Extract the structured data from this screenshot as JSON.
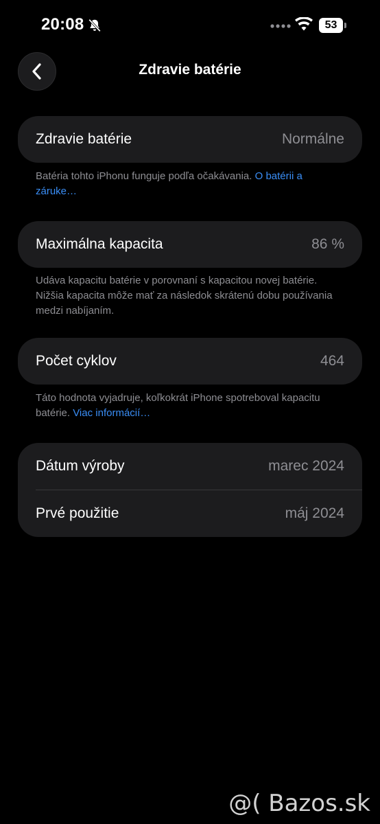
{
  "status_bar": {
    "time": "20:08",
    "battery_level": 53,
    "battery_text": "53"
  },
  "nav": {
    "title": "Zdravie batérie"
  },
  "health": {
    "label": "Zdravie batérie",
    "value": "Normálne",
    "note": "Batéria tohto iPhonu funguje podľa očakávania. ",
    "link": "O batérii a záruke…"
  },
  "capacity": {
    "label": "Maximálna kapacita",
    "value": "86 %",
    "note": "Udáva kapacitu batérie v porovnaní s kapacitou novej batérie. Nižšia kapacita môže mať za následok skrátenú dobu používania medzi nabíjaním."
  },
  "cycles": {
    "label": "Počet cyklov",
    "value": "464",
    "note": "Táto hodnota vyjadruje, koľkokrát iPhone spotreboval kapacitu batérie. ",
    "link": "Viac informácií…"
  },
  "dates": {
    "manufactured_label": "Dátum výroby",
    "manufactured_value": "marec 2024",
    "first_use_label": "Prvé použitie",
    "first_use_value": "máj 2024"
  },
  "watermark": "@( Bazos.sk",
  "colors": {
    "background": "#000000",
    "card": "#1c1c1e",
    "secondary_text": "#8e8e93",
    "link": "#3a8ef6"
  },
  "icons": [
    "bell-slash-icon",
    "cellular-dots-icon",
    "wifi-icon",
    "battery-icon",
    "chevron-left-icon"
  ]
}
